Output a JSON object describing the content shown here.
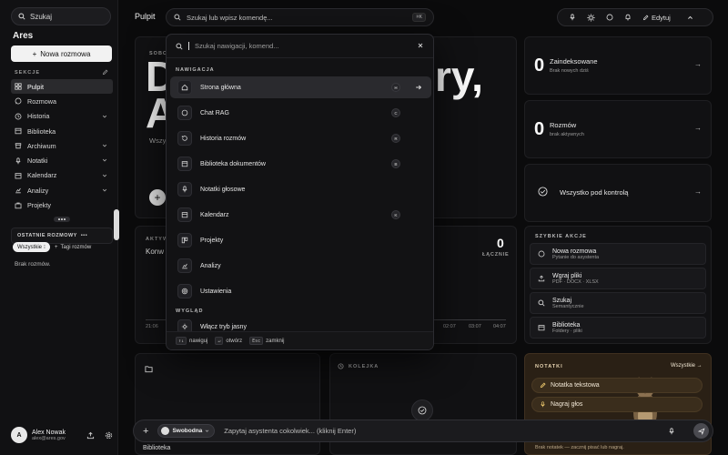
{
  "sidebar": {
    "search_label": "Szukaj",
    "brand": "Ares",
    "new_chat": "Nowa rozmowa",
    "section_heading": "SEKCJE",
    "items": [
      {
        "label": "Pulpit",
        "icon": "grid-icon",
        "active": true
      },
      {
        "label": "Rozmowa",
        "icon": "chat-icon"
      },
      {
        "label": "Historia",
        "icon": "clock-icon",
        "expandable": true
      },
      {
        "label": "Biblioteka",
        "icon": "folder-icon"
      },
      {
        "label": "Archiwum",
        "icon": "archive-icon",
        "expandable": true
      },
      {
        "label": "Notatki",
        "icon": "mic-icon",
        "expandable": true
      },
      {
        "label": "Kalendarz",
        "icon": "calendar-icon",
        "expandable": true
      },
      {
        "label": "Analizy",
        "icon": "chart-icon",
        "expandable": true
      },
      {
        "label": "Projekty",
        "icon": "projects-icon"
      }
    ],
    "recent_heading": "OSTATNIE ROZMOWY",
    "filter_all": "Wszystkie",
    "filter_tags": "Tagi rozmów",
    "empty_recent": "Brak rozmów.",
    "user": {
      "initial": "A",
      "name": "Alex Nowak",
      "email": "alex@ares.gov"
    }
  },
  "topbar": {
    "page_title": "Pulpit",
    "search_placeholder": "Szukaj lub wpisz komendę...",
    "search_shortcut": "⌘K",
    "edit_label": "Edytuj"
  },
  "hero": {
    "day_label": "SOBOTA",
    "greeting_line1": "D",
    "greeting_suffix": "ry,",
    "greeting_line2": "A",
    "subtitle": "Wszy"
  },
  "stats": [
    {
      "value": "0",
      "title": "Zaindeksowane",
      "sub": "Brak nowych dziś"
    },
    {
      "value": "0",
      "title": "Rozmów",
      "sub": "brak aktywnych"
    }
  ],
  "status_card": {
    "title": "Wszystko pod kontrolą"
  },
  "activity": {
    "label": "AKTYW",
    "title": "Konw",
    "total_value": "0",
    "total_label": "ŁĄCZNIE",
    "ticks": [
      "21:06",
      "02:07",
      "03:07",
      "04:07"
    ]
  },
  "quick_actions": {
    "heading": "SZYBKIE AKCJE",
    "items": [
      {
        "title": "Nowa rozmowa",
        "sub": "Pytanie do asystenta",
        "icon": "chat-icon"
      },
      {
        "title": "Wgraj pliki",
        "sub": "PDF · DOCX · XLSX",
        "icon": "upload-icon"
      },
      {
        "title": "Szukaj",
        "sub": "Semantycznie",
        "icon": "search-icon"
      },
      {
        "title": "Biblioteka",
        "sub": "Foldery · pliki",
        "icon": "folder-icon"
      }
    ]
  },
  "queue": {
    "label": "KOLEJKA"
  },
  "library_card": {
    "label": "Biblioteka"
  },
  "notes": {
    "heading": "NOTATKI",
    "all_link": "Wszystkie",
    "text_note": "Notatka tekstowa",
    "voice_note": "Nagraj głos",
    "empty": "Brak notatek — zacznij pisać lub nagraj."
  },
  "composer": {
    "mode": "Swobodna",
    "placeholder": "Zapytaj asystenta cokolwiek... (kliknij Enter)"
  },
  "palette": {
    "placeholder": "Szukaj nawigacji, komend...",
    "group_nav": "NAWIGACJA",
    "group_look": "WYGLĄD",
    "items": [
      {
        "label": "Strona główna",
        "key": "H",
        "icon": "home-icon"
      },
      {
        "label": "Chat RAG",
        "key": "C",
        "icon": "chat-icon"
      },
      {
        "label": "Historia rozmów",
        "key": "R",
        "icon": "history-icon"
      },
      {
        "label": "Biblioteka dokumentów",
        "key": "B",
        "icon": "folder-icon"
      },
      {
        "label": "Notatki głosowe",
        "key": "",
        "icon": "mic-icon"
      },
      {
        "label": "Kalendarz",
        "key": "K",
        "icon": "calendar-icon"
      },
      {
        "label": "Projekty",
        "key": "",
        "icon": "projects-icon"
      },
      {
        "label": "Analizy",
        "key": "",
        "icon": "chart-icon"
      },
      {
        "label": "Ustawienia",
        "key": "",
        "icon": "settings-icon"
      }
    ],
    "theme_item": "Włącz tryb jasny",
    "footer": [
      {
        "key": "↑↓",
        "label": "nawiguj"
      },
      {
        "key": "↵",
        "label": "otwórz"
      },
      {
        "key": "Esc",
        "label": "zamknij"
      }
    ]
  }
}
